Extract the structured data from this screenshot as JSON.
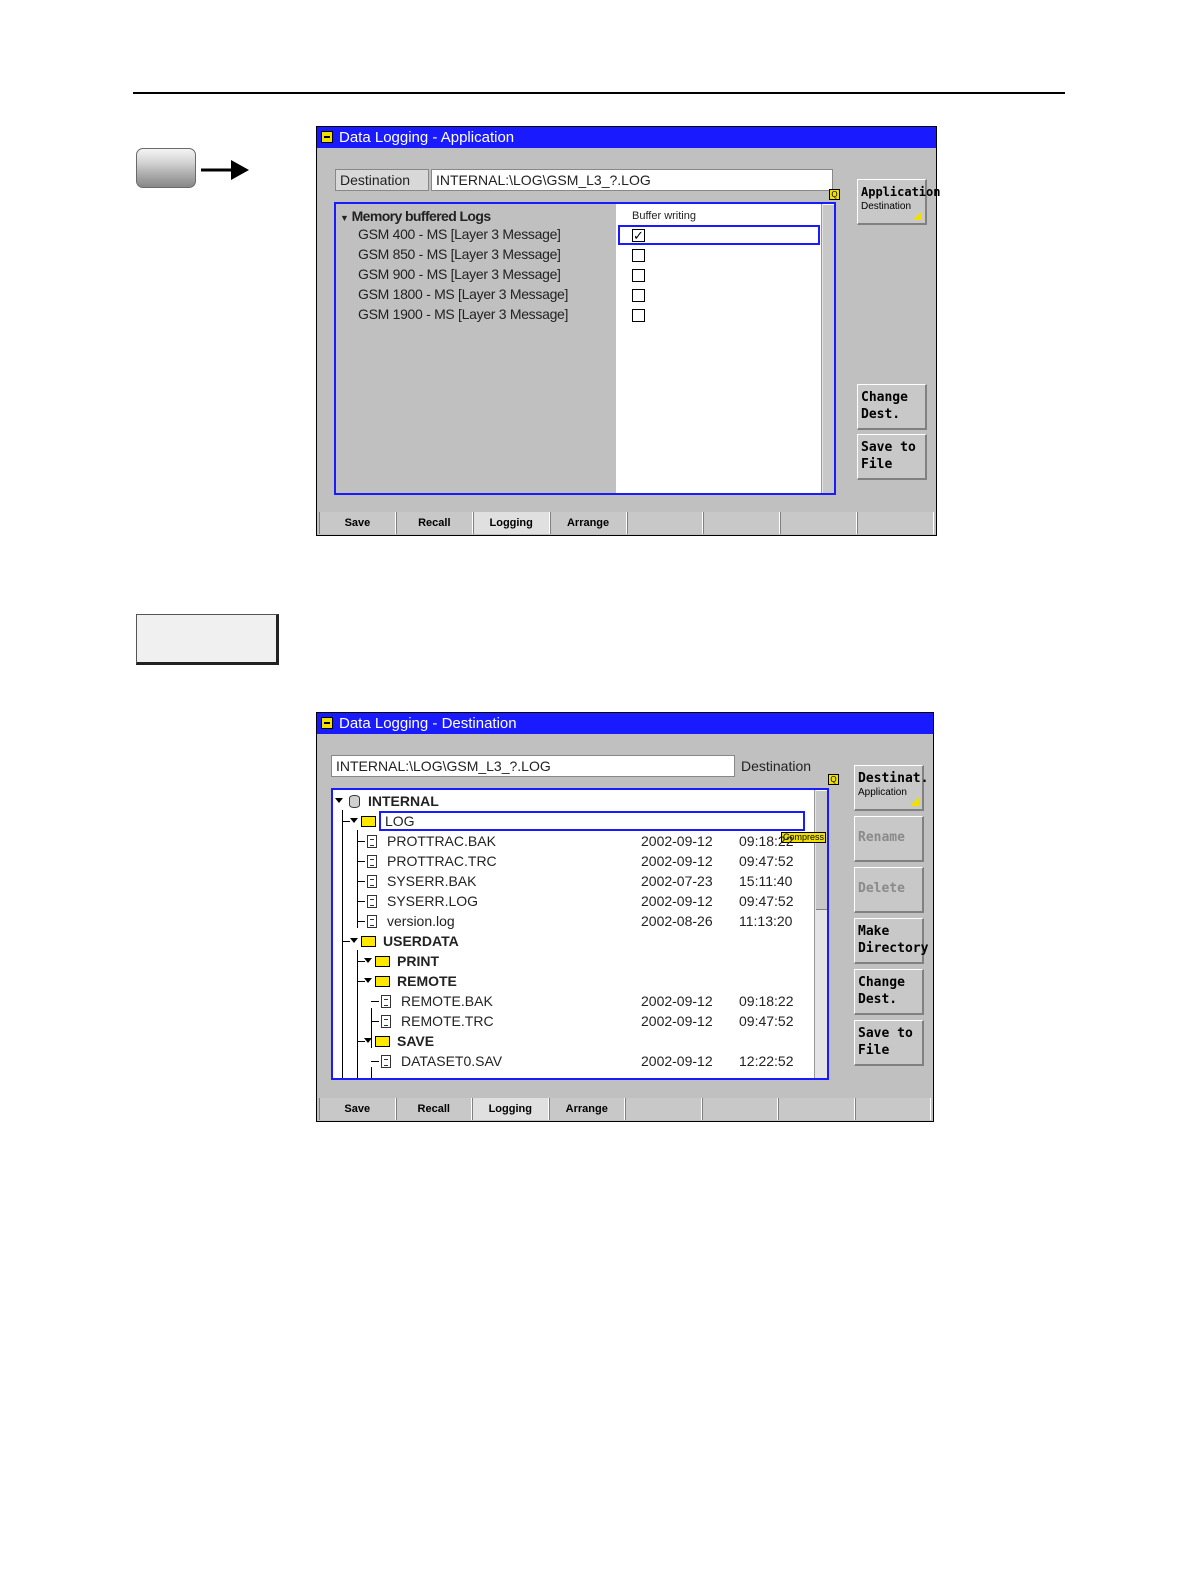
{
  "app_window": {
    "title": "Data Logging - Application",
    "destination_label": "Destination",
    "destination_value": "INTERNAL:\\LOG\\GSM_L3_?.LOG",
    "tree_header": "Memory buffered Logs",
    "column_header": "Buffer writing",
    "logs": [
      {
        "label": "GSM 400 - MS [Layer 3 Message]",
        "checked": true
      },
      {
        "label": "GSM 850 - MS [Layer 3 Message]",
        "checked": false
      },
      {
        "label": "GSM 900 - MS [Layer 3 Message]",
        "checked": false
      },
      {
        "label": "GSM 1800 - MS [Layer 3 Message]",
        "checked": false
      },
      {
        "label": "GSM 1900 - MS [Layer 3 Message]",
        "checked": false
      }
    ],
    "softkeys": {
      "application": {
        "main": "Application",
        "sub": "Destination"
      },
      "change_dest": "Change\nDest.",
      "save_to_file": "Save to\nFile"
    },
    "tabs": [
      "Save",
      "Recall",
      "Logging",
      "Arrange",
      "",
      "",
      "",
      ""
    ],
    "active_tab": "Logging"
  },
  "dest_window": {
    "title": "Data Logging - Destination",
    "destination_value": "INTERNAL:\\LOG\\GSM_L3_?.LOG",
    "destination_label": "Destination",
    "compress_label": "Compress",
    "tree": {
      "root": "INTERNAL",
      "log_folder": "LOG",
      "log_files": [
        {
          "name": "PROTTRAC.BAK",
          "date": "2002-09-12",
          "time": "09:18:22"
        },
        {
          "name": "PROTTRAC.TRC",
          "date": "2002-09-12",
          "time": "09:47:52"
        },
        {
          "name": "SYSERR.BAK",
          "date": "2002-07-23",
          "time": "15:11:40"
        },
        {
          "name": "SYSERR.LOG",
          "date": "2002-09-12",
          "time": "09:47:52"
        },
        {
          "name": "version.log",
          "date": "2002-08-26",
          "time": "11:13:20"
        }
      ],
      "userdata_folder": "USERDATA",
      "print_folder": "PRINT",
      "remote_folder": "REMOTE",
      "remote_files": [
        {
          "name": "REMOTE.BAK",
          "date": "2002-09-12",
          "time": "09:18:22"
        },
        {
          "name": "REMOTE.TRC",
          "date": "2002-09-12",
          "time": "09:47:52"
        }
      ],
      "save_folder": "SAVE",
      "save_files": [
        {
          "name": "DATASET0.SAV",
          "date": "2002-09-12",
          "time": "12:22:52"
        }
      ]
    },
    "softkeys": {
      "destinat": {
        "main": "Destinat.",
        "sub": "Application"
      },
      "rename": "Rename",
      "delete": "Delete",
      "make_directory": "Make\nDirectory",
      "change_dest": "Change\nDest.",
      "save_to_file": "Save to\nFile"
    },
    "tabs": [
      "Save",
      "Recall",
      "Logging",
      "Arrange",
      "",
      "",
      "",
      ""
    ],
    "active_tab": "Logging"
  }
}
